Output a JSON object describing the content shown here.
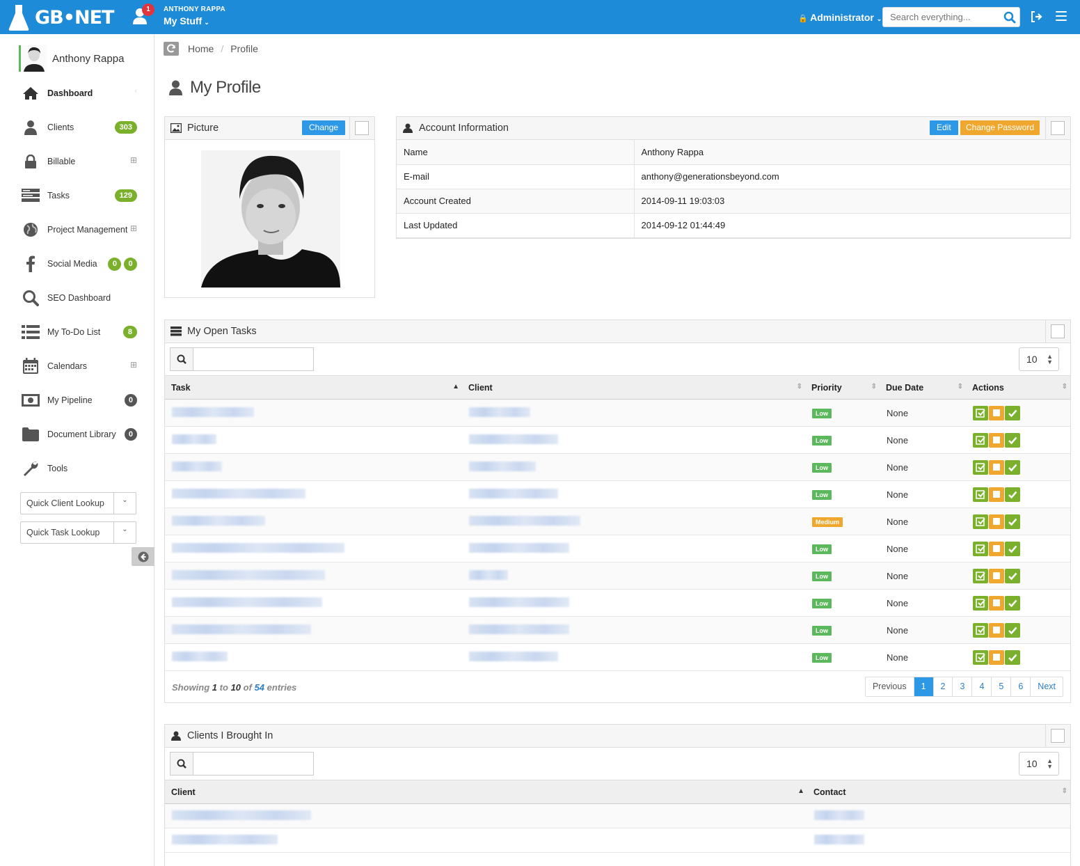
{
  "topbar": {
    "logo_text": "GB•NET",
    "notification_count": "1",
    "user_name": "ANTHONY RAPPA",
    "my_stuff": "My Stuff",
    "admin_label": "Administrator",
    "search_placeholder": "Search everything..."
  },
  "sidebar": {
    "user_name": "Anthony Rappa",
    "items": [
      {
        "label": "Dashboard",
        "icon": "home-icon"
      },
      {
        "label": "Clients",
        "icon": "user-icon",
        "badge": "303"
      },
      {
        "label": "Billable",
        "icon": "lock-icon"
      },
      {
        "label": "Tasks",
        "icon": "tasks-icon",
        "badge": "129"
      },
      {
        "label": "Project Management",
        "icon": "globe-icon"
      },
      {
        "label": "Social Media",
        "icon": "facebook-icon",
        "badge_a": "0",
        "badge_b": "0"
      },
      {
        "label": "SEO Dashboard",
        "icon": "search-icon"
      },
      {
        "label": "My To-Do List",
        "icon": "list-icon",
        "badge": "8"
      },
      {
        "label": "Calendars",
        "icon": "calendar-icon"
      },
      {
        "label": "My Pipeline",
        "icon": "money-icon",
        "badge": "0"
      },
      {
        "label": "Document Library",
        "icon": "folder-icon",
        "badge": "0"
      },
      {
        "label": "Tools",
        "icon": "wrench-icon"
      }
    ],
    "quick_client": "Quick Client Lookup",
    "quick_task": "Quick Task Lookup"
  },
  "breadcrumb": {
    "home": "Home",
    "current": "Profile"
  },
  "page_title": "My Profile",
  "picture_panel": {
    "title": "Picture",
    "change_label": "Change"
  },
  "account_panel": {
    "title": "Account Information",
    "edit_label": "Edit",
    "change_password_label": "Change Password",
    "rows": [
      {
        "key": "Name",
        "value": "Anthony Rappa"
      },
      {
        "key": "E-mail",
        "value": "anthony@generationsbeyond.com"
      },
      {
        "key": "Account Created",
        "value": "2014-09-11 19:03:03"
      },
      {
        "key": "Last Updated",
        "value": "2014-09-12 01:44:49"
      }
    ]
  },
  "tasks_panel": {
    "title": "My Open Tasks",
    "page_length": "10",
    "columns": [
      "Task",
      "Client",
      "Priority",
      "Due Date",
      "Actions"
    ],
    "priorities": [
      "Low",
      "Low",
      "Low",
      "Low",
      "Medium",
      "Low",
      "Low",
      "Low",
      "Low",
      "Low"
    ],
    "due_dates": [
      "None",
      "None",
      "None",
      "None",
      "None",
      "None",
      "None",
      "None",
      "None",
      "None"
    ],
    "info": {
      "prefix": "Showing",
      "from": "1",
      "to_word": "to",
      "to": "10",
      "of_word": "of",
      "total": "54",
      "suffix": "entries"
    },
    "pager": [
      "Previous",
      "1",
      "2",
      "3",
      "4",
      "5",
      "6",
      "Next"
    ]
  },
  "clients_panel": {
    "title": "Clients I Brought In",
    "page_length": "10",
    "columns": [
      "Client",
      "Contact"
    ]
  },
  "colors": {
    "primary": "#1e8bd8",
    "success": "#7ab02c",
    "warning": "#f0a72d",
    "danger": "#e0353e"
  }
}
